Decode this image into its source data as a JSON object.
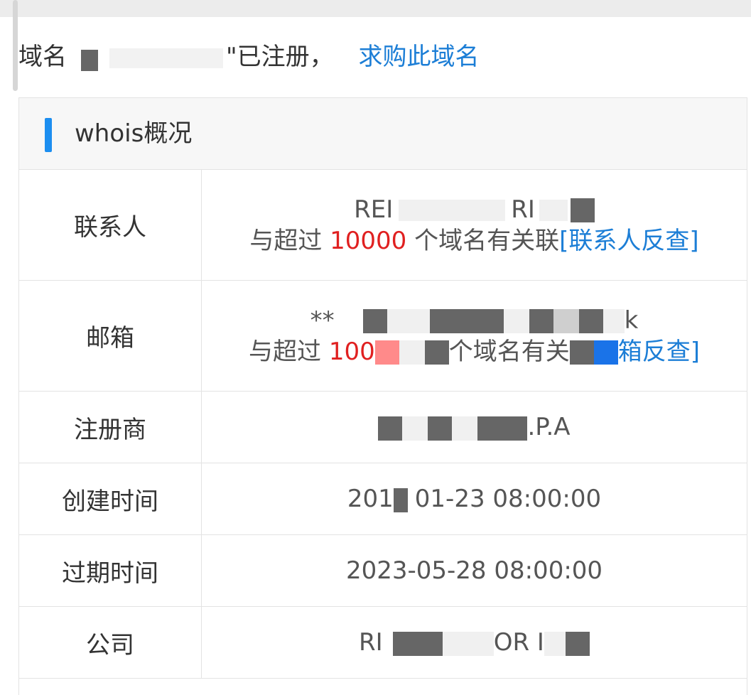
{
  "notice": {
    "prefix": "域名",
    "middle": "\"已注册，",
    "buy_link": "求购此域名"
  },
  "card": {
    "title": "whois概况"
  },
  "rows": {
    "contact": {
      "label": "联系人",
      "line1_start": "REI",
      "line1_mid": "RI",
      "line2_prefix": "与超过 ",
      "line2_count": "10000",
      "line2_suffix": " 个域名有关联",
      "line2_link": "[联系人反查]"
    },
    "email": {
      "label": "邮箱",
      "line1_start": "**",
      "line1_end": "k",
      "line2_prefix": "与超过 ",
      "line2_count": "100",
      "line2_mid": "个域名有关",
      "line2_link": "箱反查]"
    },
    "registrar": {
      "label": "注册商",
      "value_end": ".P.A"
    },
    "created": {
      "label": "创建时间",
      "value_start": "201",
      "value_end": "01-23 08:00:00"
    },
    "expires": {
      "label": "过期时间",
      "value": "2023-05-28 08:00:00"
    },
    "company": {
      "label": "公司",
      "value_start": "RI",
      "value_mid": "OR I"
    }
  },
  "colors": {
    "accent": "#1c8ef0",
    "link": "#1c7ed6",
    "highlight": "#e02020"
  }
}
